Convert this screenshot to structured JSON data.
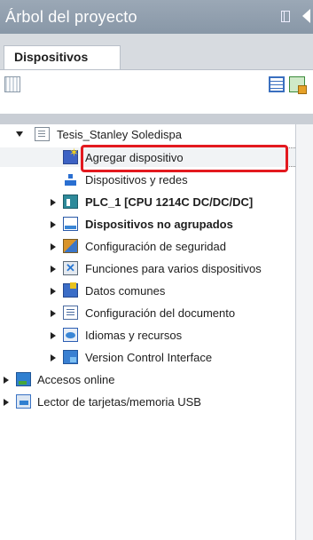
{
  "panel": {
    "title": "Árbol del proyecto"
  },
  "tabs": [
    {
      "label": "Dispositivos"
    }
  ],
  "toolbar": {
    "icons": [
      "device-config-icon",
      "view-details-icon",
      "add-device-toolbar-icon"
    ]
  },
  "tree": {
    "project": "Tesis_Stanley Soledispa",
    "items": [
      {
        "label": "Agregar dispositivo",
        "icon": "add-device-icon"
      },
      {
        "label": "Dispositivos y redes",
        "icon": "network-icon"
      },
      {
        "label": "PLC_1 [CPU 1214C DC/DC/DC]",
        "icon": "plc-icon"
      },
      {
        "label": "Dispositivos no agrupados",
        "icon": "ungrouped-devices-icon"
      },
      {
        "label": "Configuración de seguridad",
        "icon": "security-icon"
      },
      {
        "label": "Funciones para varios dispositivos",
        "icon": "multi-device-functions-icon"
      },
      {
        "label": "Datos comunes",
        "icon": "common-data-icon"
      },
      {
        "label": "Configuración del documento",
        "icon": "document-settings-icon"
      },
      {
        "label": "Idiomas y recursos",
        "icon": "languages-icon"
      },
      {
        "label": "Version Control Interface",
        "icon": "version-control-icon"
      }
    ],
    "roots": [
      {
        "label": "Accesos online",
        "icon": "online-access-icon"
      },
      {
        "label": "Lector de tarjetas/memoria USB",
        "icon": "card-reader-icon"
      }
    ]
  },
  "colors": {
    "highlight": "#e3191f",
    "header": "#8897a7"
  }
}
